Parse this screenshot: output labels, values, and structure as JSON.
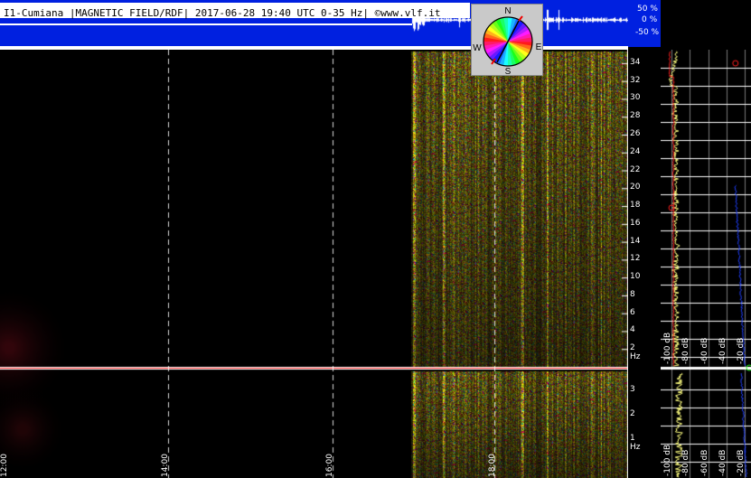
{
  "header": {
    "title": "I1-Cumiana |MAGNETIC FIELD/RDF| 2017-06-28 19:40 UTC 0-35 Hz| ©www.vlf.it",
    "pct_labels": [
      "50 %",
      "0 %",
      "-50 %"
    ]
  },
  "compass": {
    "n": "N",
    "s": "S",
    "e": "E",
    "w": "W"
  },
  "colors": {
    "header_blue": "#0020e0",
    "spectrum_yellow": "#c8c800",
    "line_red": "#ff2020",
    "line_white": "#ffffff"
  },
  "chart_data": [
    {
      "type": "heatmap",
      "title": "I1-Cumiana |MAGNETIC FIELD/RDF| 2017-06-28 19:40 UTC 0-35 Hz| ©www.vlf.it",
      "upper_panel": {
        "ylabel_ticks": [
          "34",
          "32",
          "30",
          "28",
          "26",
          "24",
          "22",
          "20",
          "18",
          "16",
          "14",
          "12",
          "10",
          "8",
          "6",
          "4",
          "2 Hz"
        ],
        "ylim": [
          0,
          35
        ]
      },
      "lower_panel": {
        "ylabel_ticks": [
          "3",
          "2",
          "1 Hz"
        ],
        "ylim": [
          0,
          4
        ]
      },
      "x_ticks": [
        "12:00",
        "14:00",
        "16:00",
        "18:00"
      ],
      "data_start": "17:10"
    },
    {
      "type": "line",
      "xlabel_ticks": [
        "-100 dB",
        "-80 dB",
        "-60 dB",
        "-40 dB",
        "-20 dB"
      ],
      "xlim": [
        -110,
        -15
      ],
      "series": [
        {
          "color": "#ffff80"
        },
        {
          "color": "#ff2020"
        },
        {
          "color": "#2040ff"
        }
      ]
    }
  ]
}
